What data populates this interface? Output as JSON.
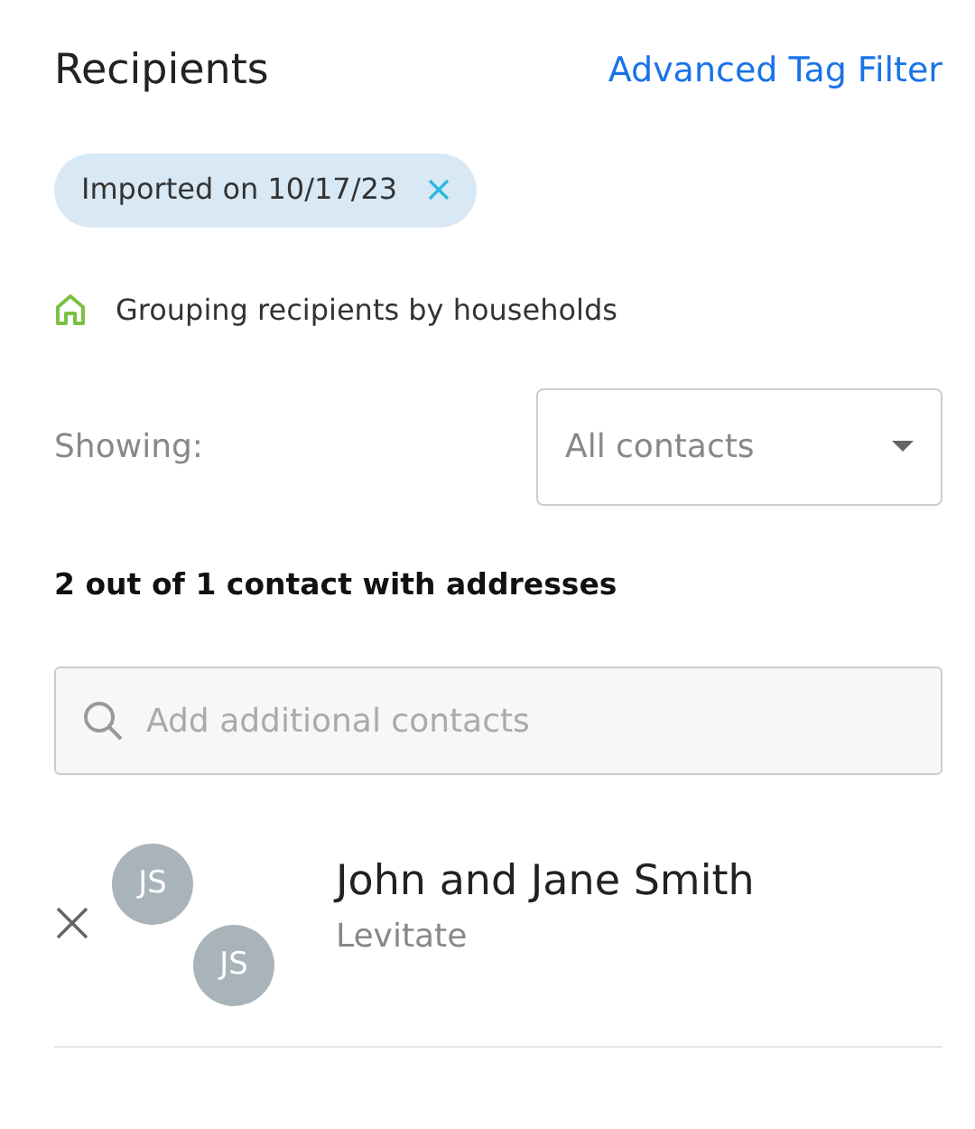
{
  "header": {
    "title": "Recipients",
    "link": "Advanced Tag Filter"
  },
  "tags": [
    {
      "label": "Imported on 10/17/23"
    }
  ],
  "grouping_note": "Grouping recipients by households",
  "filter": {
    "label": "Showing:",
    "value": "All contacts"
  },
  "summary": "2 out of 1 contact with addresses",
  "search": {
    "placeholder": "Add additional contacts"
  },
  "recipients": [
    {
      "avatars": [
        "JS",
        "JS"
      ],
      "name": "John and Jane Smith",
      "company": "Levitate"
    }
  ]
}
